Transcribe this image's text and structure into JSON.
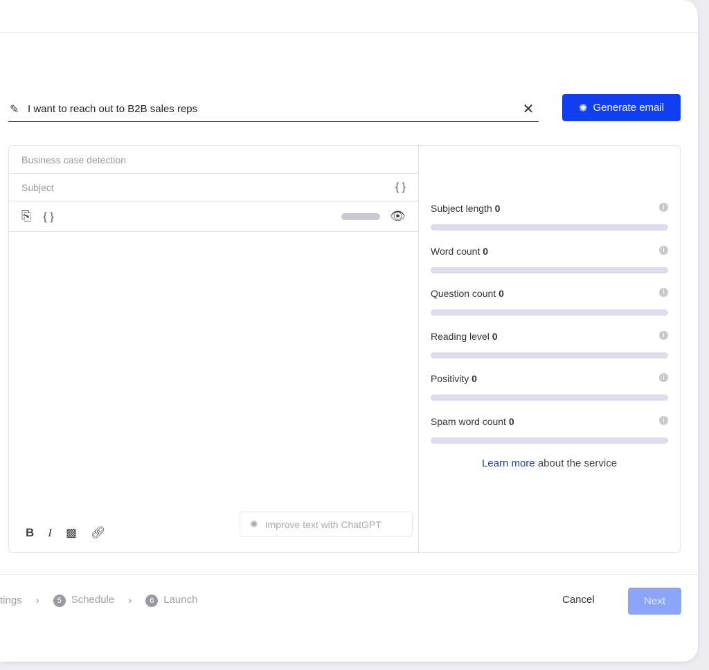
{
  "prompt": {
    "value": "I want to reach out to B2B sales reps",
    "icon": "magic-wand-icon"
  },
  "generate_label": "Generate email",
  "editor": {
    "business_case_placeholder": "Business case detection",
    "subject_placeholder": "Subject",
    "variables_icon": "{ }",
    "improve_label": "Improve text with ChatGPT",
    "format": {
      "bold": "B",
      "italic": "I"
    }
  },
  "metrics": [
    {
      "label": "Subject length",
      "value": "0",
      "fill": 0
    },
    {
      "label": "Word count",
      "value": "0",
      "fill": 0
    },
    {
      "label": "Question count",
      "value": "0",
      "fill": 0
    },
    {
      "label": "Reading level",
      "value": "0",
      "fill": 0
    },
    {
      "label": "Positivity",
      "value": "0",
      "fill": 0
    },
    {
      "label": "Spam word count",
      "value": "0",
      "fill": 0
    }
  ],
  "learn": {
    "link": "Learn more",
    "rest": " about the service"
  },
  "steps": [
    {
      "label": "tings"
    },
    {
      "num": "5",
      "label": "Schedule"
    },
    {
      "num": "6",
      "label": "Launch"
    }
  ],
  "footer": {
    "cancel": "Cancel",
    "next": "Next"
  },
  "colors": {
    "accent": "#0f3ff0",
    "next_disabled": "#8ca5f8"
  }
}
